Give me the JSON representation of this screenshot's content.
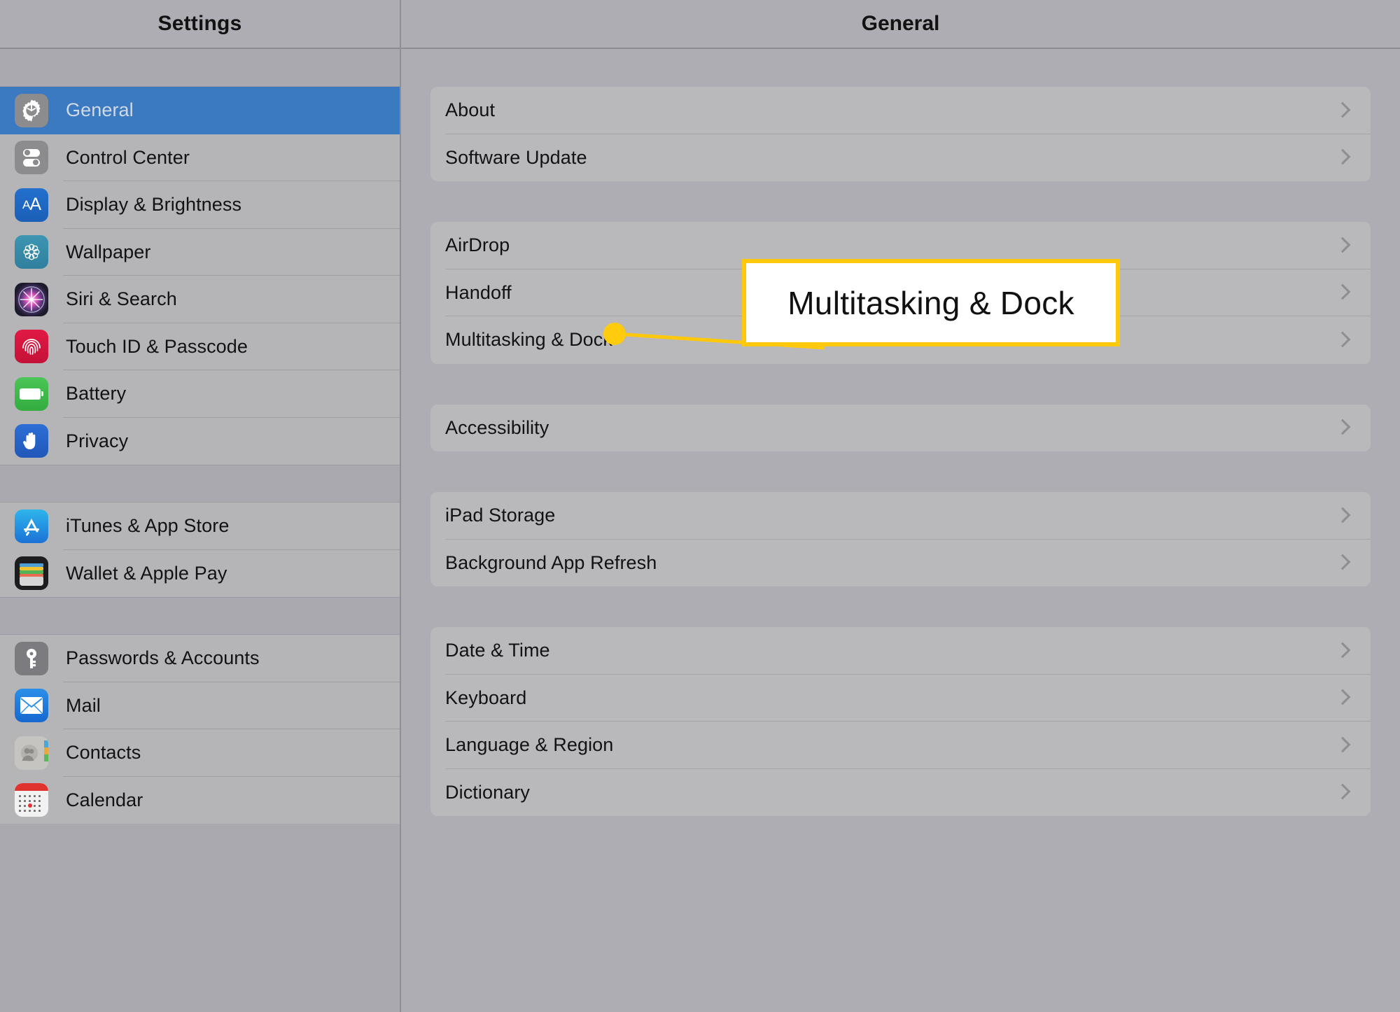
{
  "sidebar": {
    "title": "Settings",
    "groups": [
      {
        "items": [
          {
            "label": "General",
            "icon": "gear-icon",
            "selected": true
          },
          {
            "label": "Control Center",
            "icon": "control-center-icon",
            "selected": false
          },
          {
            "label": "Display & Brightness",
            "icon": "display-brightness-icon",
            "selected": false
          },
          {
            "label": "Wallpaper",
            "icon": "wallpaper-icon",
            "selected": false
          },
          {
            "label": "Siri & Search",
            "icon": "siri-icon",
            "selected": false
          },
          {
            "label": "Touch ID & Passcode",
            "icon": "fingerprint-icon",
            "selected": false
          },
          {
            "label": "Battery",
            "icon": "battery-icon",
            "selected": false
          },
          {
            "label": "Privacy",
            "icon": "hand-icon",
            "selected": false
          }
        ]
      },
      {
        "items": [
          {
            "label": "iTunes & App Store",
            "icon": "app-store-icon",
            "selected": false
          },
          {
            "label": "Wallet & Apple Pay",
            "icon": "wallet-icon",
            "selected": false
          }
        ]
      },
      {
        "items": [
          {
            "label": "Passwords & Accounts",
            "icon": "key-icon",
            "selected": false
          },
          {
            "label": "Mail",
            "icon": "mail-icon",
            "selected": false
          },
          {
            "label": "Contacts",
            "icon": "contacts-icon",
            "selected": false
          },
          {
            "label": "Calendar",
            "icon": "calendar-icon",
            "selected": false
          }
        ]
      }
    ]
  },
  "main": {
    "title": "General",
    "groups": [
      {
        "items": [
          {
            "label": "About",
            "accessory": "chevron-right-icon"
          },
          {
            "label": "Software Update",
            "accessory": "chevron-right-icon"
          }
        ]
      },
      {
        "items": [
          {
            "label": "AirDrop",
            "accessory": "chevron-right-icon"
          },
          {
            "label": "Handoff",
            "accessory": "chevron-right-icon"
          },
          {
            "label": "Multitasking & Dock",
            "accessory": "chevron-right-icon"
          }
        ]
      },
      {
        "items": [
          {
            "label": "Accessibility",
            "accessory": "chevron-right-icon"
          }
        ]
      },
      {
        "items": [
          {
            "label": "iPad Storage",
            "accessory": "chevron-right-icon"
          },
          {
            "label": "Background App Refresh",
            "accessory": "chevron-right-icon"
          }
        ]
      },
      {
        "items": [
          {
            "label": "Date & Time",
            "accessory": "chevron-right-icon"
          },
          {
            "label": "Keyboard",
            "accessory": "chevron-right-icon"
          },
          {
            "label": "Language & Region",
            "accessory": "chevron-right-icon"
          },
          {
            "label": "Dictionary",
            "accessory": "chevron-right-icon"
          }
        ]
      }
    ]
  },
  "callout": {
    "text": "Multitasking & Dock",
    "border_color": "#ffc80b",
    "background_color": "#ffffff",
    "text_color": "#111111",
    "leader_color": "#ffc80b",
    "marker_color": "#ffcc0d"
  },
  "colors": {
    "selected_row": "#3b79c0",
    "row_background": "#b9b9bb",
    "panel_background": "#adadb3",
    "separator": "#a5a5a8",
    "label_text": "#111215"
  }
}
